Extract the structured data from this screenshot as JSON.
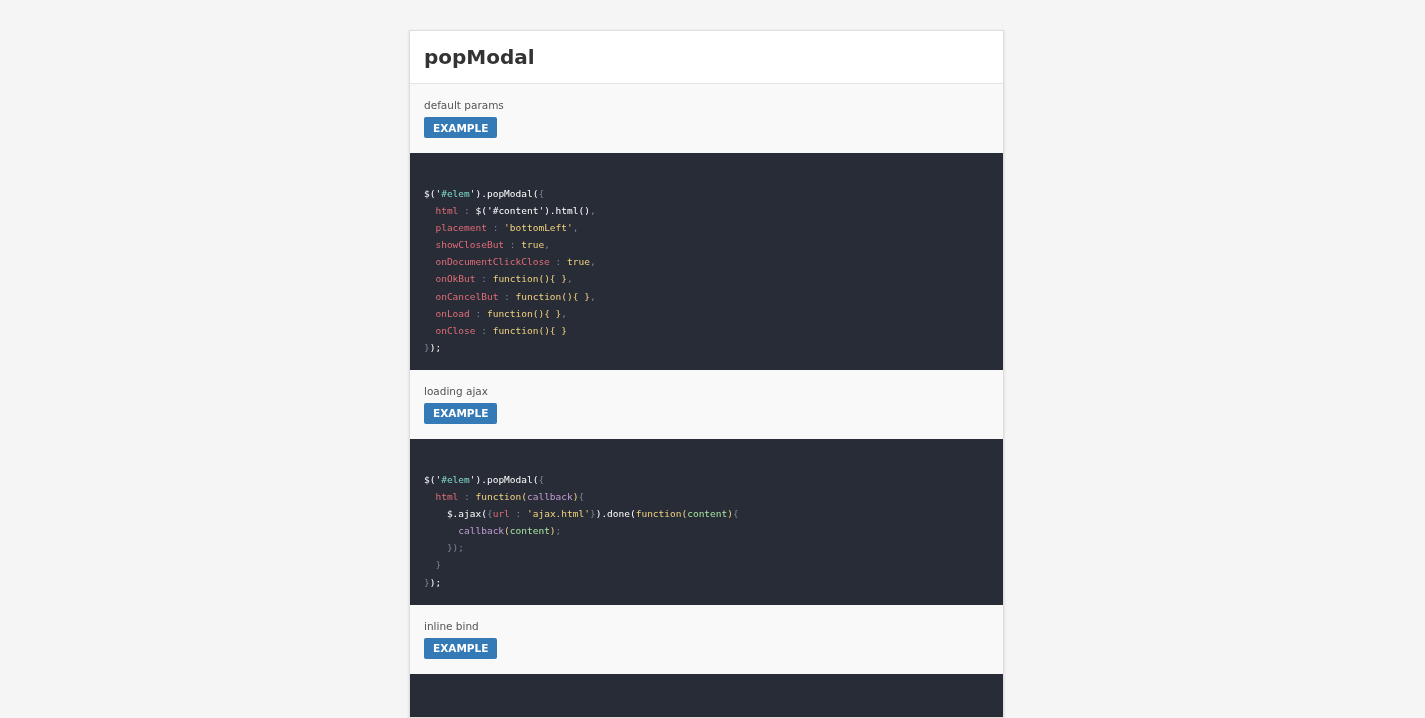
{
  "title": "popModal",
  "sections": [
    {
      "label": "default params",
      "button": "EXAMPLE",
      "code": [
        [
          {
            "kind": "text",
            "t": "$('"
          },
          {
            "kind": "sel",
            "t": "#elem"
          },
          {
            "kind": "text",
            "t": "').popModal("
          },
          {
            "kind": "punct",
            "t": "{"
          }
        ],
        [
          {
            "kind": "prop",
            "t": "  html"
          },
          {
            "kind": "punct",
            "t": " : "
          },
          {
            "kind": "text",
            "t": "$('#content').html()"
          },
          {
            "kind": "punct",
            "t": ","
          }
        ],
        [
          {
            "kind": "prop",
            "t": "  placement"
          },
          {
            "kind": "punct",
            "t": " : "
          },
          {
            "kind": "str",
            "t": "'bottomLeft'"
          },
          {
            "kind": "punct",
            "t": ","
          }
        ],
        [
          {
            "kind": "prop",
            "t": "  showCloseBut"
          },
          {
            "kind": "punct",
            "t": " : "
          },
          {
            "kind": "str",
            "t": "true"
          },
          {
            "kind": "punct",
            "t": ","
          }
        ],
        [
          {
            "kind": "prop",
            "t": "  onDocumentClickClose"
          },
          {
            "kind": "punct",
            "t": " : "
          },
          {
            "kind": "str",
            "t": "true"
          },
          {
            "kind": "punct",
            "t": ","
          }
        ],
        [
          {
            "kind": "prop",
            "t": "  onOkBut"
          },
          {
            "kind": "punct",
            "t": " : "
          },
          {
            "kind": "str",
            "t": "function(){ }"
          },
          {
            "kind": "punct",
            "t": ","
          }
        ],
        [
          {
            "kind": "prop",
            "t": "  onCancelBut"
          },
          {
            "kind": "punct",
            "t": " : "
          },
          {
            "kind": "str",
            "t": "function(){ }"
          },
          {
            "kind": "punct",
            "t": ","
          }
        ],
        [
          {
            "kind": "prop",
            "t": "  onLoad"
          },
          {
            "kind": "punct",
            "t": " : "
          },
          {
            "kind": "str",
            "t": "function(){ }"
          },
          {
            "kind": "punct",
            "t": ","
          }
        ],
        [
          {
            "kind": "prop",
            "t": "  onClose"
          },
          {
            "kind": "punct",
            "t": " : "
          },
          {
            "kind": "str",
            "t": "function(){ }"
          }
        ],
        [
          {
            "kind": "punct",
            "t": "}"
          },
          {
            "kind": "text",
            "t": ");"
          }
        ]
      ]
    },
    {
      "label": "loading ajax",
      "button": "EXAMPLE",
      "code": [
        [
          {
            "kind": "text",
            "t": "$('"
          },
          {
            "kind": "sel",
            "t": "#elem"
          },
          {
            "kind": "text",
            "t": "').popModal("
          },
          {
            "kind": "punct",
            "t": "{"
          }
        ],
        [
          {
            "kind": "prop",
            "t": "  html"
          },
          {
            "kind": "punct",
            "t": " : "
          },
          {
            "kind": "str",
            "t": "function("
          },
          {
            "kind": "param",
            "t": "callback"
          },
          {
            "kind": "str",
            "t": ")"
          },
          {
            "kind": "punct",
            "t": "{"
          }
        ],
        [
          {
            "kind": "text",
            "t": "    $.ajax("
          },
          {
            "kind": "punct",
            "t": "{"
          },
          {
            "kind": "prop",
            "t": "url"
          },
          {
            "kind": "punct",
            "t": " : "
          },
          {
            "kind": "str",
            "t": "'ajax.html'"
          },
          {
            "kind": "punct",
            "t": "}"
          },
          {
            "kind": "text",
            "t": ").done("
          },
          {
            "kind": "str",
            "t": "function("
          },
          {
            "kind": "arg",
            "t": "content"
          },
          {
            "kind": "str",
            "t": ")"
          },
          {
            "kind": "punct",
            "t": "{"
          }
        ],
        [
          {
            "kind": "param",
            "t": "      callback"
          },
          {
            "kind": "str",
            "t": "("
          },
          {
            "kind": "arg",
            "t": "content"
          },
          {
            "kind": "str",
            "t": ")"
          },
          {
            "kind": "punct",
            "t": ";"
          }
        ],
        [
          {
            "kind": "punct",
            "t": "    });"
          }
        ],
        [
          {
            "kind": "punct",
            "t": "  }"
          }
        ],
        [
          {
            "kind": "punct",
            "t": "}"
          },
          {
            "kind": "text",
            "t": ");"
          }
        ]
      ]
    },
    {
      "label": "inline bind",
      "button": "EXAMPLE"
    }
  ]
}
